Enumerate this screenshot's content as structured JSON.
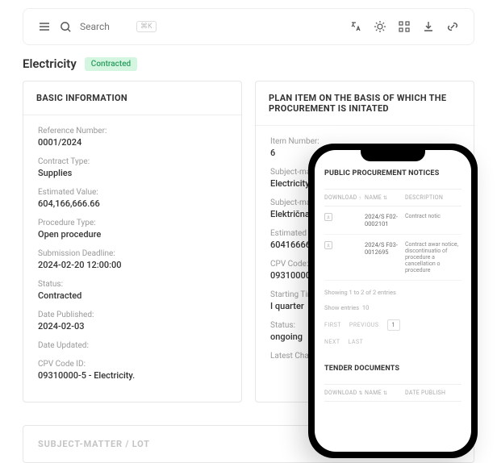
{
  "topbar": {
    "search_placeholder": "Search",
    "shortcut": "⌘K"
  },
  "title": "Electricity",
  "status_badge": "Contracted",
  "basic": {
    "heading": "BASIC INFORMATION",
    "fields": [
      {
        "label": "Reference Number:",
        "value": "0001/2024"
      },
      {
        "label": "Contract Type:",
        "value": "Supplies"
      },
      {
        "label": "Estimated Value:",
        "value": "604,166,666.66"
      },
      {
        "label": "Procedure Type:",
        "value": "Open procedure"
      },
      {
        "label": "Submission Deadline:",
        "value": "2024-02-20 12:00:00"
      },
      {
        "label": "Status:",
        "value": "Contracted"
      },
      {
        "label": "Date Published:",
        "value": "2024-02-03"
      },
      {
        "label": "Date Updated:",
        "value": ""
      },
      {
        "label": "CPV Code ID:",
        "value": "09310000-5 - Electricity."
      }
    ]
  },
  "plan": {
    "heading": "PLAN ITEM ON THE BASIS OF WHICH THE PROCUREMENT IS INITATED",
    "fields": [
      {
        "label": "Item Number:",
        "value": "6"
      },
      {
        "label": "Subject-matter of P",
        "value": "Electricity"
      },
      {
        "label": "Subject-matter Nam",
        "value": "Električna energija"
      },
      {
        "label": "Estimated Value:",
        "value": "604166666.66"
      },
      {
        "label": "CPV Code:",
        "value": "09310000-5 - Electr"
      },
      {
        "label": "Starting Time:",
        "value": "I quarter"
      },
      {
        "label": "Status:",
        "value": "ongoing"
      },
      {
        "label": "Latest Change:",
        "value": ""
      }
    ]
  },
  "section2_heading": "SUBJECT-MATTER / LOT",
  "phone": {
    "notices": {
      "heading": "PUBLIC PROCUREMENT NOTICES",
      "cols": {
        "c1": "DOWNLOAD",
        "c2": "NAME",
        "c3": "DESCRIPTION"
      },
      "rows": [
        {
          "name": "2024/S F02-0002101",
          "desc": "Contract notic"
        },
        {
          "name": "2024/S F03-0012695",
          "desc": "Contract awar notice, discontinuatio of procedure a cancellation o procedure"
        }
      ],
      "showing": "Showing 1 to 2 of 2 entries",
      "show_entries_label": "Show entries",
      "show_entries_value": "10",
      "pager": {
        "first": "FIRST",
        "prev": "PREVIOUS",
        "page": "1",
        "next": "NEXT",
        "last": "LAST"
      }
    },
    "tender": {
      "heading": "TENDER DOCUMENTS",
      "cols": {
        "c1": "DOWNLOAD",
        "c2": "NAME",
        "c3": "DATE PUBLISH"
      }
    }
  }
}
